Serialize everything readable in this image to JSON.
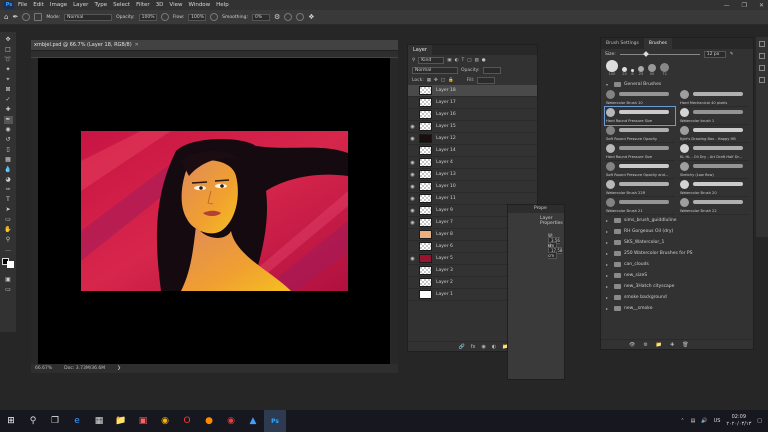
{
  "menubar": {
    "logo": "Ps",
    "items": [
      "File",
      "Edit",
      "Image",
      "Layer",
      "Type",
      "Select",
      "Filter",
      "3D",
      "View",
      "Window",
      "Help"
    ]
  },
  "options": {
    "mode_label": "Mode:",
    "mode_value": "Normal",
    "opacity_label": "Opacity:",
    "opacity_value": "100%",
    "flow_label": "Flow:",
    "flow_value": "100%",
    "smoothing_label": "Smoothing:",
    "smoothing_value": "0%"
  },
  "document": {
    "tab_title": "xmbjel.psd @ 66.7% (Layer 18, RGB/8)",
    "zoom": "66.67%",
    "doc_size": "Doc: 3.73M/36.6M"
  },
  "layers_panel": {
    "tab": "Layer",
    "kind_label": "Kind",
    "blend_mode": "Normal",
    "opacity_label": "Opacity:",
    "fill_label": "Fill:",
    "lock_label": "Lock:",
    "layers": [
      {
        "name": "Layer 18",
        "visible": false,
        "selected": true,
        "thumb": "transparent"
      },
      {
        "name": "Layer 17",
        "visible": false,
        "selected": false,
        "thumb": "transparent"
      },
      {
        "name": "Layer 16",
        "visible": false,
        "selected": false,
        "thumb": "transparent"
      },
      {
        "name": "Layer 15",
        "visible": true,
        "selected": false,
        "thumb": "transparent"
      },
      {
        "name": "Layer 12",
        "visible": true,
        "selected": false,
        "thumb": "dark"
      },
      {
        "name": "Layer 14",
        "visible": false,
        "selected": false,
        "thumb": "transparent"
      },
      {
        "name": "Layer 4",
        "visible": true,
        "selected": false,
        "thumb": "transparent"
      },
      {
        "name": "Layer 13",
        "visible": true,
        "selected": false,
        "thumb": "transparent"
      },
      {
        "name": "Layer 10",
        "visible": true,
        "selected": false,
        "thumb": "transparent"
      },
      {
        "name": "Layer 11",
        "visible": true,
        "selected": false,
        "thumb": "transparent"
      },
      {
        "name": "Layer 9",
        "visible": true,
        "selected": false,
        "thumb": "transparent"
      },
      {
        "name": "Layer 7",
        "visible": true,
        "selected": false,
        "thumb": "transparent"
      },
      {
        "name": "Layer 8",
        "visible": false,
        "selected": false,
        "thumb": "skin"
      },
      {
        "name": "Layer 6",
        "visible": false,
        "selected": false,
        "thumb": "transparent"
      },
      {
        "name": "Layer 5",
        "visible": true,
        "selected": false,
        "thumb": "crimson"
      },
      {
        "name": "Layer 3",
        "visible": false,
        "selected": false,
        "thumb": "transparent"
      },
      {
        "name": "Layer 2",
        "visible": false,
        "selected": false,
        "thumb": "transparent"
      },
      {
        "name": "Layer 1",
        "visible": false,
        "selected": false,
        "thumb": "white"
      }
    ]
  },
  "properties_panel": {
    "tab": "Prope",
    "title": "Layer Properties",
    "w_label": "W:",
    "w_value": "3.56 cm",
    "h_label": "H:",
    "h_value": "17.58 cm",
    "x_label": "X:",
    "x_value": "0 cm",
    "y_label": "Y:",
    "y_value": "0 cm"
  },
  "brushes_panel": {
    "tabs": [
      "Brush Settings",
      "Brushes"
    ],
    "active_tab": "Brushes",
    "size_label": "Size:",
    "size_value": "12 px",
    "presets": [
      "100",
      "20",
      "8",
      "25",
      "50",
      "72"
    ],
    "group_name": "General Brushes",
    "brushes": [
      {
        "name": "Watercolor Brush 10",
        "selected": false
      },
      {
        "name": "Hard Mechanical 40 pixels",
        "selected": false
      },
      {
        "name": "Hard Round Pressure Size",
        "selected": true
      },
      {
        "name": "Watercolor brush 1",
        "selected": false
      },
      {
        "name": "Soft Round Pressure Opacity",
        "selected": false
      },
      {
        "name": "Kyle's Drawing Box - Happy HB",
        "selected": false
      },
      {
        "name": "Hard Round Pressure Size",
        "selected": false
      },
      {
        "name": "KL HL - Oil Dry - Art Draft Half Dr...",
        "selected": false
      },
      {
        "name": "Soft Round Pressure Opacity and...",
        "selected": false
      },
      {
        "name": "Sketchy (Low flow)",
        "selected": false
      },
      {
        "name": "Watercolor Brush 22R",
        "selected": false
      },
      {
        "name": "Watercolor Brush 20",
        "selected": false
      },
      {
        "name": "Watercolor Brush 21",
        "selected": false
      },
      {
        "name": "Watercolor Brush 22",
        "selected": false
      }
    ],
    "folders": [
      "sims_brush_guiddluline",
      "RH Gorgeous Oil (dry)",
      "SKS_Watercolor_1",
      "250 Watercolor Brushes for PS",
      "can_clouds",
      "new_sizeS",
      "new_3Hatch cityscape",
      "smoke background",
      "new__smoke"
    ]
  },
  "taskbar": {
    "time": "02:09",
    "date": "٢٠٢٠/٠٣/١٣",
    "lang": "US"
  }
}
